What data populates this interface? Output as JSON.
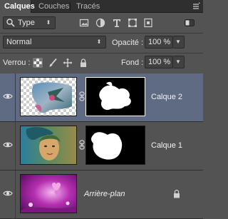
{
  "tabs": [
    {
      "label": "Calques",
      "active": true
    },
    {
      "label": "Couches",
      "active": false
    },
    {
      "label": "Tracés",
      "active": false
    }
  ],
  "filter": {
    "value": "Type"
  },
  "blend": {
    "mode": "Normal",
    "opacity_label": "Opacité :",
    "opacity_value": "100 %"
  },
  "lock_row": {
    "label": "Verrou :",
    "fill_label": "Fond :",
    "fill_value": "100 %"
  },
  "layers": [
    {
      "name": "Calque 2",
      "selected": true,
      "has_mask": true
    },
    {
      "name": "Calque 1",
      "selected": false,
      "has_mask": true
    },
    {
      "name": "Arrière-plan",
      "selected": false,
      "has_mask": false,
      "locked": true
    }
  ],
  "colors": {
    "panel": "#535353",
    "tabbar": "#2f2f2f",
    "selected": "#5e6b82",
    "field": "#414141"
  }
}
